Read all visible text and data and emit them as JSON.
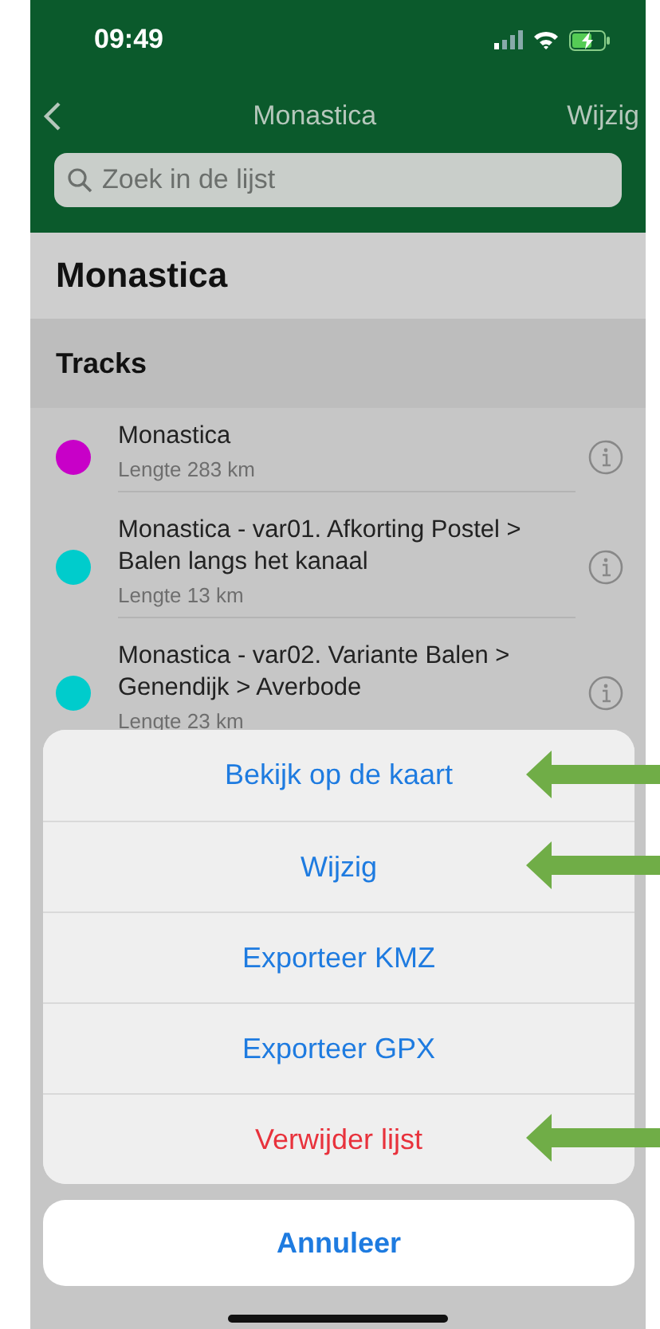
{
  "status_bar": {
    "time": "09:49"
  },
  "nav": {
    "title": "Monastica",
    "action": "Wijzig"
  },
  "search": {
    "placeholder": "Zoek in de lijst"
  },
  "list_title": "Monastica",
  "section": "Tracks",
  "tracks": [
    {
      "name": "Monastica",
      "length": "Lengte 283 km",
      "color": "#c800c8"
    },
    {
      "name": "Monastica - var01. Afkorting Postel > Balen langs het kanaal",
      "length": "Lengte 13 km",
      "color": "#00cccc"
    },
    {
      "name": "Monastica - var02. Variante Balen > Genendijk > Averbode",
      "length": "Lengte 23 km",
      "color": "#00cccc"
    }
  ],
  "action_sheet": {
    "actions": [
      {
        "label": "Bekijk op de kaart",
        "kind": "default",
        "marked": true
      },
      {
        "label": "Wijzig",
        "kind": "default",
        "marked": true
      },
      {
        "label": "Exporteer KMZ",
        "kind": "default",
        "marked": false
      },
      {
        "label": "Exporteer GPX",
        "kind": "default",
        "marked": false
      },
      {
        "label": "Verwijder lijst",
        "kind": "destructive",
        "marked": true
      }
    ],
    "cancel": "Annuleer"
  }
}
